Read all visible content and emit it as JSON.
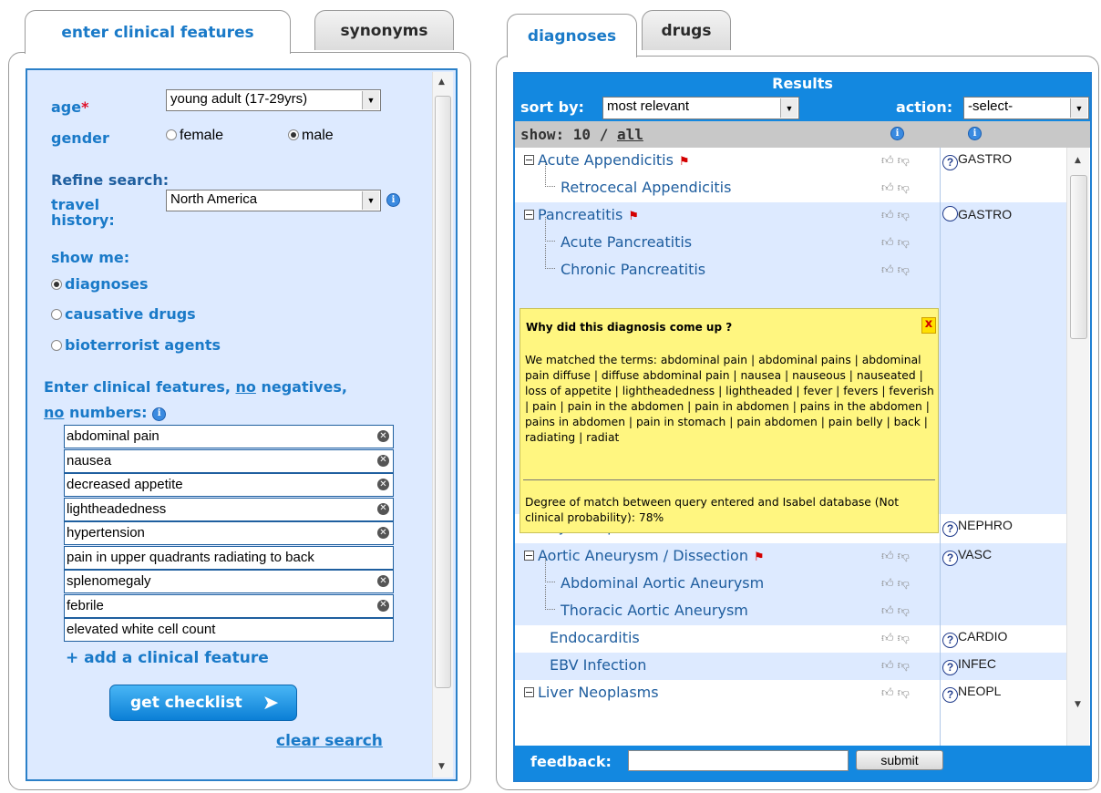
{
  "left_tabs": {
    "active": "enter clinical features",
    "other": "synonyms"
  },
  "right_tabs": {
    "active": "diagnoses",
    "other": "drugs"
  },
  "form": {
    "age_label": "age",
    "required_mark": "*",
    "age_value": "young adult (17-29yrs)",
    "gender_label": "gender",
    "gender_female": "female",
    "gender_male": "male",
    "gender_selected": "male",
    "refine_label": "Refine search:",
    "travel_label_1": "travel",
    "travel_label_2": "history:",
    "travel_value": "North America",
    "show_me_label": "show me:",
    "show_options": [
      "diagnoses",
      "causative drugs",
      "bioterrorist agents"
    ],
    "show_selected": "diagnoses",
    "enter_label_a": "Enter clinical features, ",
    "enter_label_no1": "no",
    "enter_label_b": " negatives,",
    "enter_label_no2": "no",
    "enter_label_c": " numbers:",
    "features": [
      {
        "text": "abdominal pain",
        "removable": true
      },
      {
        "text": "nausea",
        "removable": true
      },
      {
        "text": "decreased appetite",
        "removable": true
      },
      {
        "text": "lightheadedness",
        "removable": true
      },
      {
        "text": "hypertension",
        "removable": true
      },
      {
        "text": "pain in upper quadrants radiating to back",
        "removable": false
      },
      {
        "text": "splenomegaly",
        "removable": true
      },
      {
        "text": "febrile",
        "removable": true
      },
      {
        "text": "elevated white cell count",
        "removable": false
      }
    ],
    "add_feature": "+ add a clinical feature",
    "get_checklist": "get checklist",
    "clear_search": "clear search"
  },
  "results": {
    "title": "Results",
    "sort_label": "sort by:",
    "sort_value": "most relevant",
    "action_label": "action:",
    "action_value": "-select-",
    "show_label": "show: 10 / ",
    "show_all": "all",
    "rows": [
      {
        "name": "Acute Appendicitis",
        "level": 0,
        "expandable": true,
        "flag": true,
        "category": "GASTRO",
        "help": true
      },
      {
        "name": "Retrocecal Appendicitis",
        "level": 1,
        "expandable": false,
        "flag": false,
        "category": "",
        "help": false
      },
      {
        "name": "Pancreatitis",
        "level": 0,
        "expandable": true,
        "flag": true,
        "category": "GASTRO",
        "help": false
      },
      {
        "name": "Acute Pancreatitis",
        "level": 1,
        "expandable": false,
        "flag": false,
        "category": "",
        "help": false
      },
      {
        "name": "Chronic Pancreatitis",
        "level": 1,
        "expandable": false,
        "flag": false,
        "category": "",
        "help": false
      },
      {
        "name": "Pyelonephritis",
        "level": 0,
        "expandable": false,
        "flag": true,
        "category": "NEPHRO",
        "help": true
      },
      {
        "name": "Aortic Aneurysm / Dissection",
        "level": 0,
        "expandable": true,
        "flag": true,
        "category": "VASC",
        "help": true
      },
      {
        "name": "Abdominal Aortic Aneurysm",
        "level": 1,
        "expandable": false,
        "flag": false,
        "category": "",
        "help": false
      },
      {
        "name": "Thoracic Aortic Aneurysm",
        "level": 1,
        "expandable": false,
        "flag": false,
        "category": "",
        "help": false
      },
      {
        "name": "Endocarditis",
        "level": 0,
        "expandable": false,
        "flag": false,
        "category": "CARDIO",
        "help": true
      },
      {
        "name": "EBV Infection",
        "level": 0,
        "expandable": false,
        "flag": false,
        "category": "INFEC",
        "help": true
      },
      {
        "name": "Liver Neoplasms",
        "level": 0,
        "expandable": true,
        "flag": false,
        "category": "NEOPL",
        "help": true
      }
    ],
    "popup": {
      "title": "Why did this diagnosis come up ?",
      "close": "x",
      "matched": "We matched the terms: abdominal pain | abdominal pains | abdominal pain diffuse | diffuse abdominal pain | nausea | nauseous | nauseated | loss of appetite | lightheadedness | lightheaded | fever | fevers | feverish | pain | pain in the abdomen | pain in abdomen | pains in the abdomen | pains in abdomen | pain in stomach | pain abdomen | pain belly | back | radiating | radiat",
      "degree": "Degree of match between query entered and Isabel database (Not clinical probability): 78%"
    },
    "feedback_label": "feedback:",
    "submit_label": "submit"
  },
  "icons": [
    "info-icon",
    "help-icon",
    "flag-icon",
    "remove-icon",
    "chevron-right-icon",
    "thumbs-up-icon",
    "thumbs-down-icon"
  ]
}
